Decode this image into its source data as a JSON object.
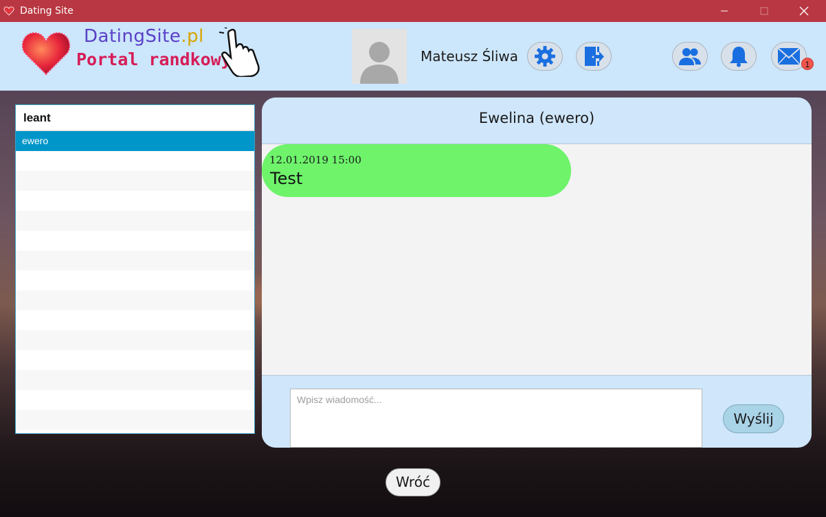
{
  "window": {
    "title": "Dating Site",
    "controls": [
      "minimize-icon",
      "maximize-icon",
      "close-icon"
    ]
  },
  "header": {
    "logo": {
      "name_main": "DatingSite",
      "name_suffix": ".pl",
      "tagline": "Portal randkowy"
    },
    "user": {
      "name": "Mateusz Śliwa"
    },
    "icons": [
      "settings-icon",
      "logout-icon",
      "friends-icon",
      "bell-icon",
      "mail-icon"
    ],
    "mail_badge": "1"
  },
  "contacts": {
    "header": "leant",
    "items": [
      {
        "label": "ewero",
        "selected": true
      }
    ]
  },
  "chat": {
    "title": "Ewelina (ewero)",
    "messages": [
      {
        "timestamp": "12.01.2019 15:00",
        "text": "Test"
      }
    ],
    "input_placeholder": "Wpisz wiadomość...",
    "send_label": "Wyślij"
  },
  "footer": {
    "back_label": "Wróć"
  },
  "colors": {
    "titlebar": "#b83742",
    "header_bg": "#cce6fb",
    "icon_blue": "#1a6fe0",
    "selected_row": "#0096c9",
    "bubble": "#6ef36b",
    "badge": "#f0554c"
  }
}
